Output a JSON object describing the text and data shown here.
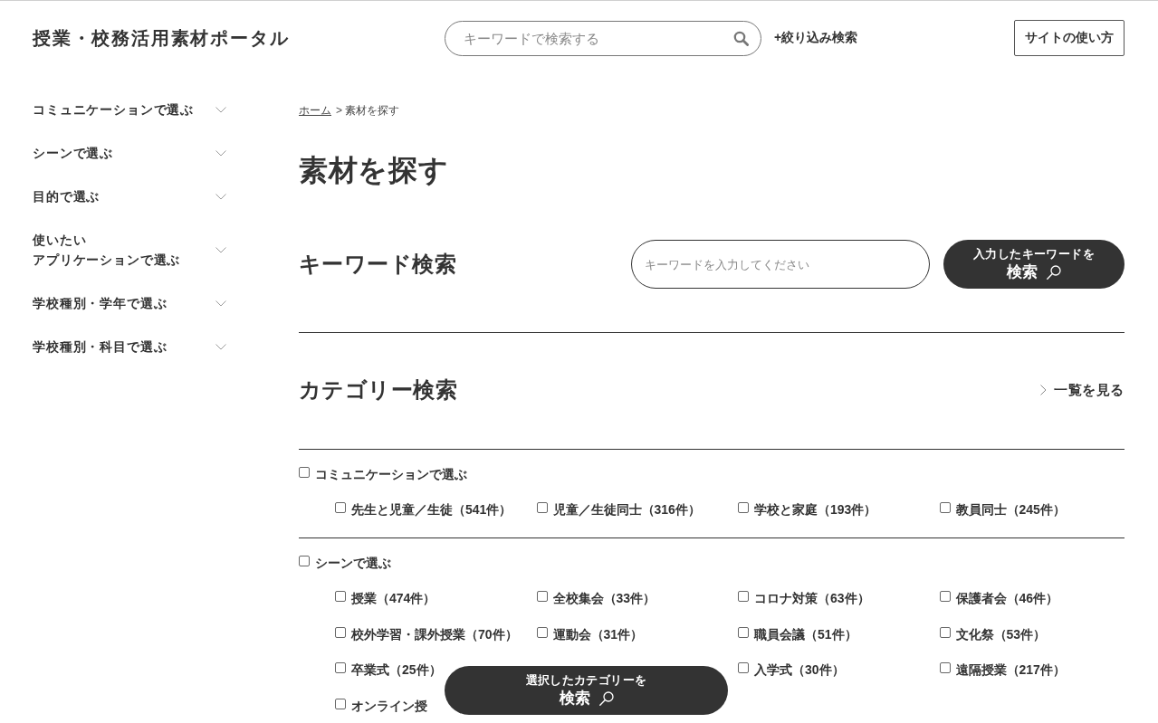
{
  "header": {
    "logo": "授業・校務活用素材ポータル",
    "search": {
      "placeholder": "キーワードで検索する"
    },
    "refine_link": "+絞り込み検索",
    "guide_button": "サイトの使い方"
  },
  "sidebar": {
    "items": [
      {
        "lines": [
          "コミュニケーションで選ぶ"
        ],
        "expanded": false
      },
      {
        "lines": [
          "シーンで選ぶ"
        ],
        "expanded": false
      },
      {
        "lines": [
          "目的で選ぶ"
        ],
        "expanded": false
      },
      {
        "lines": [
          "使いたい",
          "アプリケーションで選ぶ"
        ],
        "expanded": false
      },
      {
        "lines": [
          "学校種別・学年で選ぶ"
        ],
        "expanded": false
      },
      {
        "lines": [
          "学校種別・科目で選ぶ"
        ],
        "expanded": false
      }
    ]
  },
  "breadcrumb": {
    "separator": ">",
    "items": [
      {
        "label": "ホーム",
        "current": false
      },
      {
        "label": "素材を探す",
        "current": true
      }
    ]
  },
  "page_title": "素材を探す",
  "keyword_search": {
    "heading": "キーワード検索",
    "input": {
      "placeholder": "キーワードを入力してください"
    },
    "button": {
      "line_1": "入力したキーワードを",
      "line_2": "検索"
    }
  },
  "category_search": {
    "heading": "カテゴリー検索",
    "view_all_link": "一覧を見る",
    "groups": [
      {
        "label": "コミュニケーションで選ぶ",
        "checked": false,
        "items": [
          {
            "kind": "checkbox",
            "label": "先生と児童／生徒（541件）",
            "checked": false
          },
          {
            "kind": "checkbox",
            "label": "児童／生徒同士（316件）",
            "checked": false
          },
          {
            "kind": "checkbox",
            "label": "学校と家庭（193件）",
            "checked": false
          },
          {
            "kind": "checkbox",
            "label": "教員同士（245件）",
            "checked": false
          }
        ]
      },
      {
        "label": "シーンで選ぶ",
        "checked": false,
        "items": [
          {
            "kind": "checkbox",
            "label": "授業（474件）",
            "checked": false
          },
          {
            "kind": "checkbox",
            "label": "全校集会（33件）",
            "checked": false
          },
          {
            "kind": "checkbox",
            "label": "コロナ対策（63件）",
            "checked": false
          },
          {
            "kind": "checkbox",
            "label": "保護者会（46件）",
            "checked": false
          },
          {
            "kind": "checkbox",
            "label": "校外学習・課外授業（70件）",
            "checked": false
          },
          {
            "kind": "checkbox",
            "label": "運動会（31件）",
            "checked": false
          },
          {
            "kind": "checkbox",
            "label": "職員会議（51件）",
            "checked": false
          },
          {
            "kind": "checkbox",
            "label": "文化祭（53件）",
            "checked": false
          },
          {
            "kind": "checkbox",
            "label": "卒業式（25件）",
            "checked": false
          },
          {
            "kind": "covered"
          },
          {
            "kind": "checkbox",
            "label": "入学式（30件）",
            "checked": false
          },
          {
            "kind": "checkbox",
            "label": "遠隔授業（217件）",
            "checked": false
          },
          {
            "kind": "checkbox",
            "label": "オンライン授",
            "checked": false
          }
        ]
      }
    ]
  },
  "floating_button": {
    "line_1": "選択したカテゴリーを",
    "line_2": "検索"
  }
}
